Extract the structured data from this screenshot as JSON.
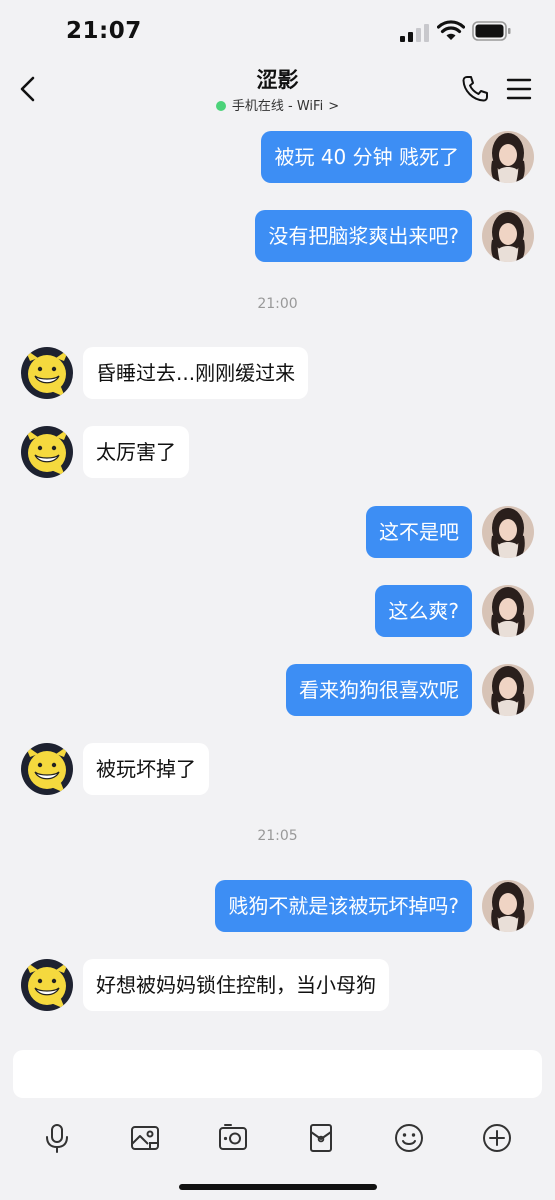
{
  "status_bar": {
    "time": "21:07"
  },
  "header": {
    "title": "涩影",
    "presence": "手机在线 - WiFi"
  },
  "messages": [
    {
      "side": "out",
      "text": "被玩 40 分钟 贱死了"
    },
    {
      "side": "out",
      "text": "没有把脑浆爽出来吧?"
    },
    {
      "timestamp": "21:00"
    },
    {
      "side": "in",
      "text": "昏睡过去...刚刚缓过来"
    },
    {
      "side": "in",
      "text": "太厉害了"
    },
    {
      "side": "out",
      "text": "这不是吧"
    },
    {
      "side": "out",
      "text": "这么爽?"
    },
    {
      "side": "out",
      "text": "看来狗狗很喜欢呢"
    },
    {
      "side": "in",
      "text": "被玩坏掉了"
    },
    {
      "timestamp": "21:05"
    },
    {
      "side": "out",
      "text": "贱狗不就是该被玩坏掉吗?"
    },
    {
      "side": "in",
      "text": "好想被妈妈锁住控制，当小母狗"
    }
  ],
  "toolbar": [
    "microphone-icon",
    "image-icon",
    "camera-icon",
    "red-packet-icon",
    "emoji-icon",
    "plus-icon"
  ],
  "colors": {
    "outgoing_bubble": "#3d8ef4",
    "incoming_bubble": "#ffffff",
    "background": "#f2f2f4",
    "online": "#4cd37a"
  }
}
